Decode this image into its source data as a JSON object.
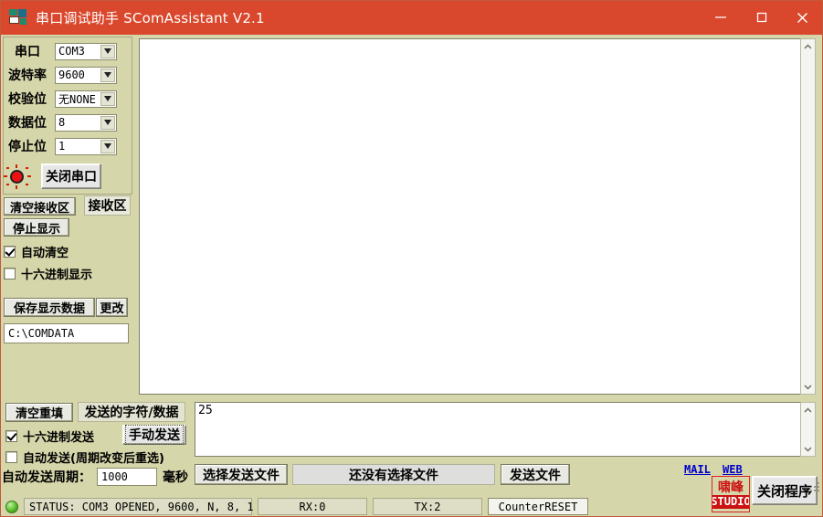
{
  "window": {
    "title": "串口调试助手 SComAssistant V2.1",
    "app_icon": "serial-app-icon",
    "minimize": "minimize-icon",
    "maximize": "maximize-icon",
    "close": "close-icon",
    "accent_color": "#d9472c",
    "panel_color": "#d6d6ab"
  },
  "settings": {
    "rows": [
      {
        "label": "串口",
        "value": "COM3"
      },
      {
        "label": "波特率",
        "value": "9600"
      },
      {
        "label": "校验位",
        "value": "无NONE"
      },
      {
        "label": "数据位",
        "value": "8"
      },
      {
        "label": "停止位",
        "value": "1"
      }
    ],
    "led_state": "on",
    "led_color": "#ee1111",
    "close_port_button": "关闭串口"
  },
  "receive": {
    "clear_button": "清空接收区",
    "area_label": "接收区",
    "stop_display_button": "停止显示",
    "auto_clear": {
      "label": "自动清空",
      "checked": true
    },
    "hex_display": {
      "label": "十六进制显示",
      "checked": false
    },
    "save_button": "保存显示数据",
    "change_button": "更改",
    "save_path": "C:\\COMDATA",
    "content": ""
  },
  "send": {
    "clear_refill_button": "清空重填",
    "data_label": "发送的字符/数据",
    "hex_send": {
      "label": "十六进制发送",
      "checked": true
    },
    "manual_send_button": "手动发送",
    "auto_send": {
      "label": "自动发送(周期改变后重选)",
      "checked": false
    },
    "period_label": "自动发送周期：",
    "period_value": "1000",
    "period_unit": "毫秒",
    "text": "25"
  },
  "file": {
    "choose_button": "选择发送文件",
    "status": "还没有选择文件",
    "send_button": "发送文件"
  },
  "links": {
    "mail": "MAIL",
    "web": "WEB"
  },
  "logo": {
    "line1": "啸峰",
    "line2": "STUDIO"
  },
  "close_program_button": "关闭程序",
  "status_bar": {
    "indicator": "green-status-led",
    "status": "STATUS: COM3 OPENED, 9600, N, 8, 1",
    "rx": "RX:0",
    "tx": "TX:2",
    "counter_reset": "CounterRESET"
  },
  "scrollbars": {
    "up_icon": "chevron-up-icon",
    "down_icon": "chevron-down-icon"
  }
}
